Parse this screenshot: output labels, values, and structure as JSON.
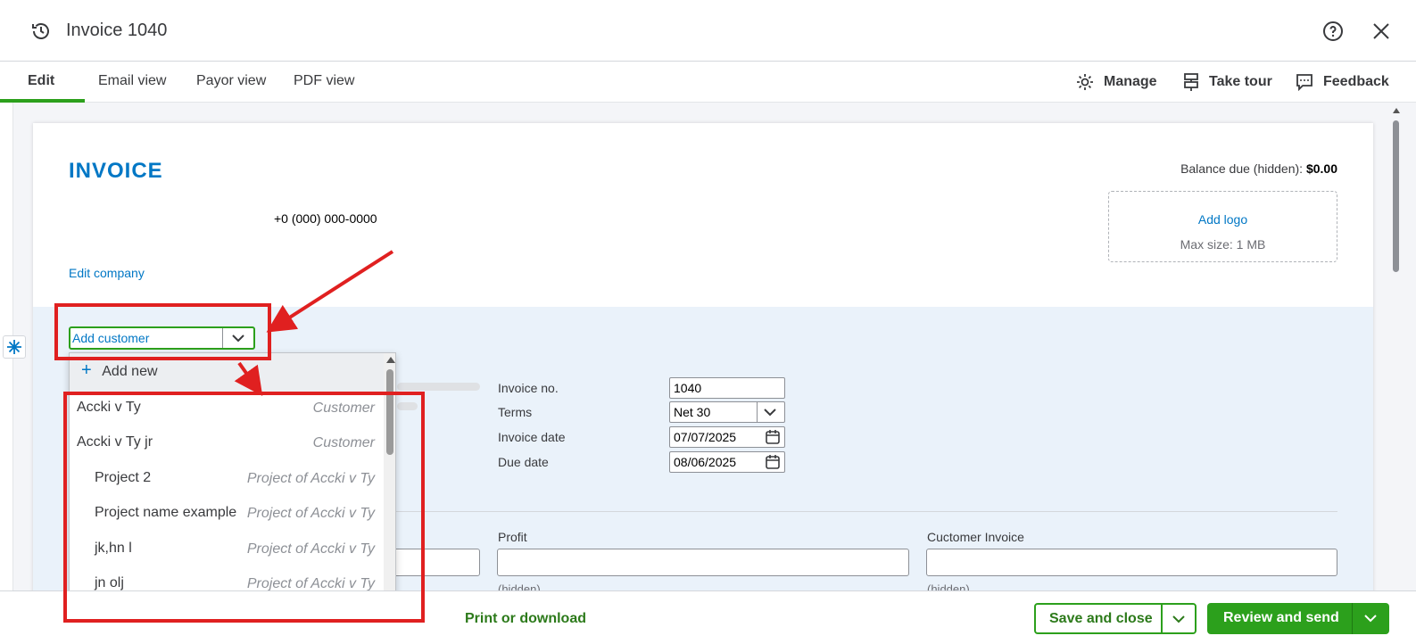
{
  "header": {
    "title": "Invoice 1040"
  },
  "tabs": [
    {
      "label": "Edit"
    },
    {
      "label": "Email view"
    },
    {
      "label": "Payor view"
    },
    {
      "label": "PDF view"
    }
  ],
  "tools": {
    "manage": "Manage",
    "take_tour": "Take tour",
    "feedback": "Feedback"
  },
  "invoice": {
    "heading": "INVOICE",
    "phone": "+0 (000) 000-0000",
    "edit_company": "Edit company",
    "balance_label": "Balance due (hidden):",
    "balance_value": "$0.00",
    "add_logo": "Add logo",
    "logo_max": "Max size: 1 MB"
  },
  "customer_select": {
    "placeholder": "Add customer"
  },
  "dropdown": {
    "add_new": "Add new",
    "items": [
      {
        "name": "Accki v Ty",
        "type": "Customer"
      },
      {
        "name": "Accki v Ty jr",
        "type": "Customer"
      },
      {
        "name": "Project 2",
        "type": "Project of Accki v Ty"
      },
      {
        "name": "Project name example",
        "type": "Project of Accki v Ty"
      },
      {
        "name": "jk,hn l",
        "type": "Project of Accki v Ty"
      },
      {
        "name": "jn olj",
        "type": "Project of Accki v Ty"
      }
    ]
  },
  "details": {
    "invoice_no_label": "Invoice no.",
    "invoice_no": "1040",
    "terms_label": "Terms",
    "terms": "Net 30",
    "invoice_date_label": "Invoice date",
    "invoice_date": "07/07/2025",
    "due_date_label": "Due date",
    "due_date": "08/06/2025"
  },
  "custom_fields": {
    "profit_label": "Profit",
    "customer_invoice_label": "Cuctomer Invoice",
    "hidden": "(hidden)"
  },
  "footer": {
    "print": "Print or download",
    "save_close": "Save and close",
    "review_send": "Review and send"
  },
  "colors": {
    "accent": "#2ca01c",
    "brand_blue": "#0077c5",
    "annotation_red": "#e02020"
  }
}
